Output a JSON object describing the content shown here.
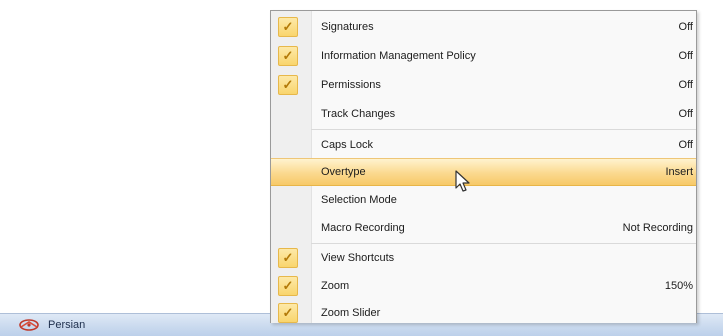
{
  "menu": {
    "items": [
      {
        "label": "Signatures",
        "value": "Off",
        "checked": true
      },
      {
        "label": "Information Management Policy",
        "value": "Off",
        "checked": true
      },
      {
        "label": "Permissions",
        "value": "Off",
        "checked": true
      },
      {
        "label": "Track Changes",
        "value": "Off",
        "checked": false
      },
      {
        "label": "Caps Lock",
        "value": "Off",
        "checked": false
      },
      {
        "label": "Overtype",
        "value": "Insert",
        "checked": false,
        "highlighted": true
      },
      {
        "label": "Selection Mode",
        "value": "",
        "checked": false
      },
      {
        "label": "Macro Recording",
        "value": "Not Recording",
        "checked": false
      },
      {
        "label": "View Shortcuts",
        "value": "",
        "checked": true
      },
      {
        "label": "Zoom",
        "value": "150%",
        "checked": true
      },
      {
        "label": "Zoom Slider",
        "value": "",
        "checked": true
      }
    ]
  },
  "statusbar": {
    "language": "Persian"
  },
  "icons": {
    "check": "checkmark-icon",
    "language": "language-icon",
    "cursor": "mouse-pointer-icon"
  },
  "colors": {
    "highlight": "#f7c968",
    "check_background": "#f9d56d",
    "statusbar": "#c9d9ee"
  }
}
